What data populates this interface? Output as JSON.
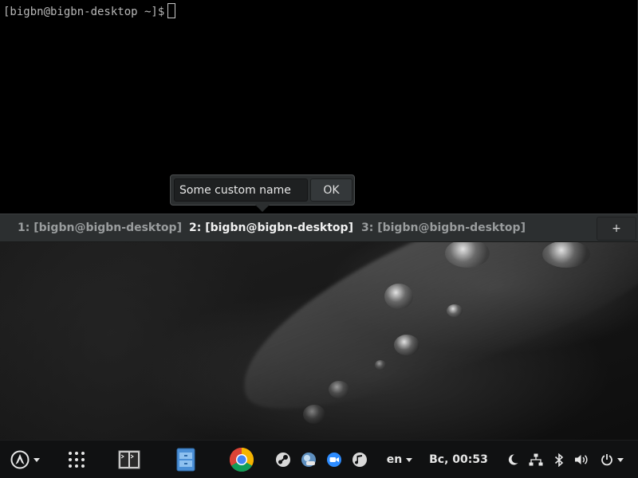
{
  "terminal": {
    "prompt": "[bigbn@bigbn-desktop ~]$"
  },
  "tabs": [
    {
      "label": "1: [bigbn@bigbn-desktop]",
      "active": false
    },
    {
      "label": "2: [bigbn@bigbn-desktop]",
      "active": true
    },
    {
      "label": "3: [bigbn@bigbn-desktop]",
      "active": false
    }
  ],
  "add_tab_label": "+",
  "rename": {
    "value": "Some custom name",
    "ok_label": "OK"
  },
  "panel": {
    "menu_icon": "arch-logo-icon",
    "launchers": [
      "apps-grid-icon",
      "terminal-icon",
      "file-manager-icon",
      "chrome-icon"
    ],
    "tray": [
      "steam-icon",
      "weather-icon",
      "zoom-icon",
      "audio-icon"
    ],
    "keyboard_layout": "en",
    "clock": "Вс, 00:53",
    "status": [
      "night-light-icon",
      "network-icon",
      "bluetooth-icon",
      "volume-icon",
      "power-icon"
    ]
  },
  "colors": {
    "terminal_bg": "#000000",
    "tabbar_bg": "#2c2f30",
    "panel_bg": "#101112",
    "active_tab_text": "#f2f2f2",
    "inactive_tab_text": "#9a9d9e"
  }
}
